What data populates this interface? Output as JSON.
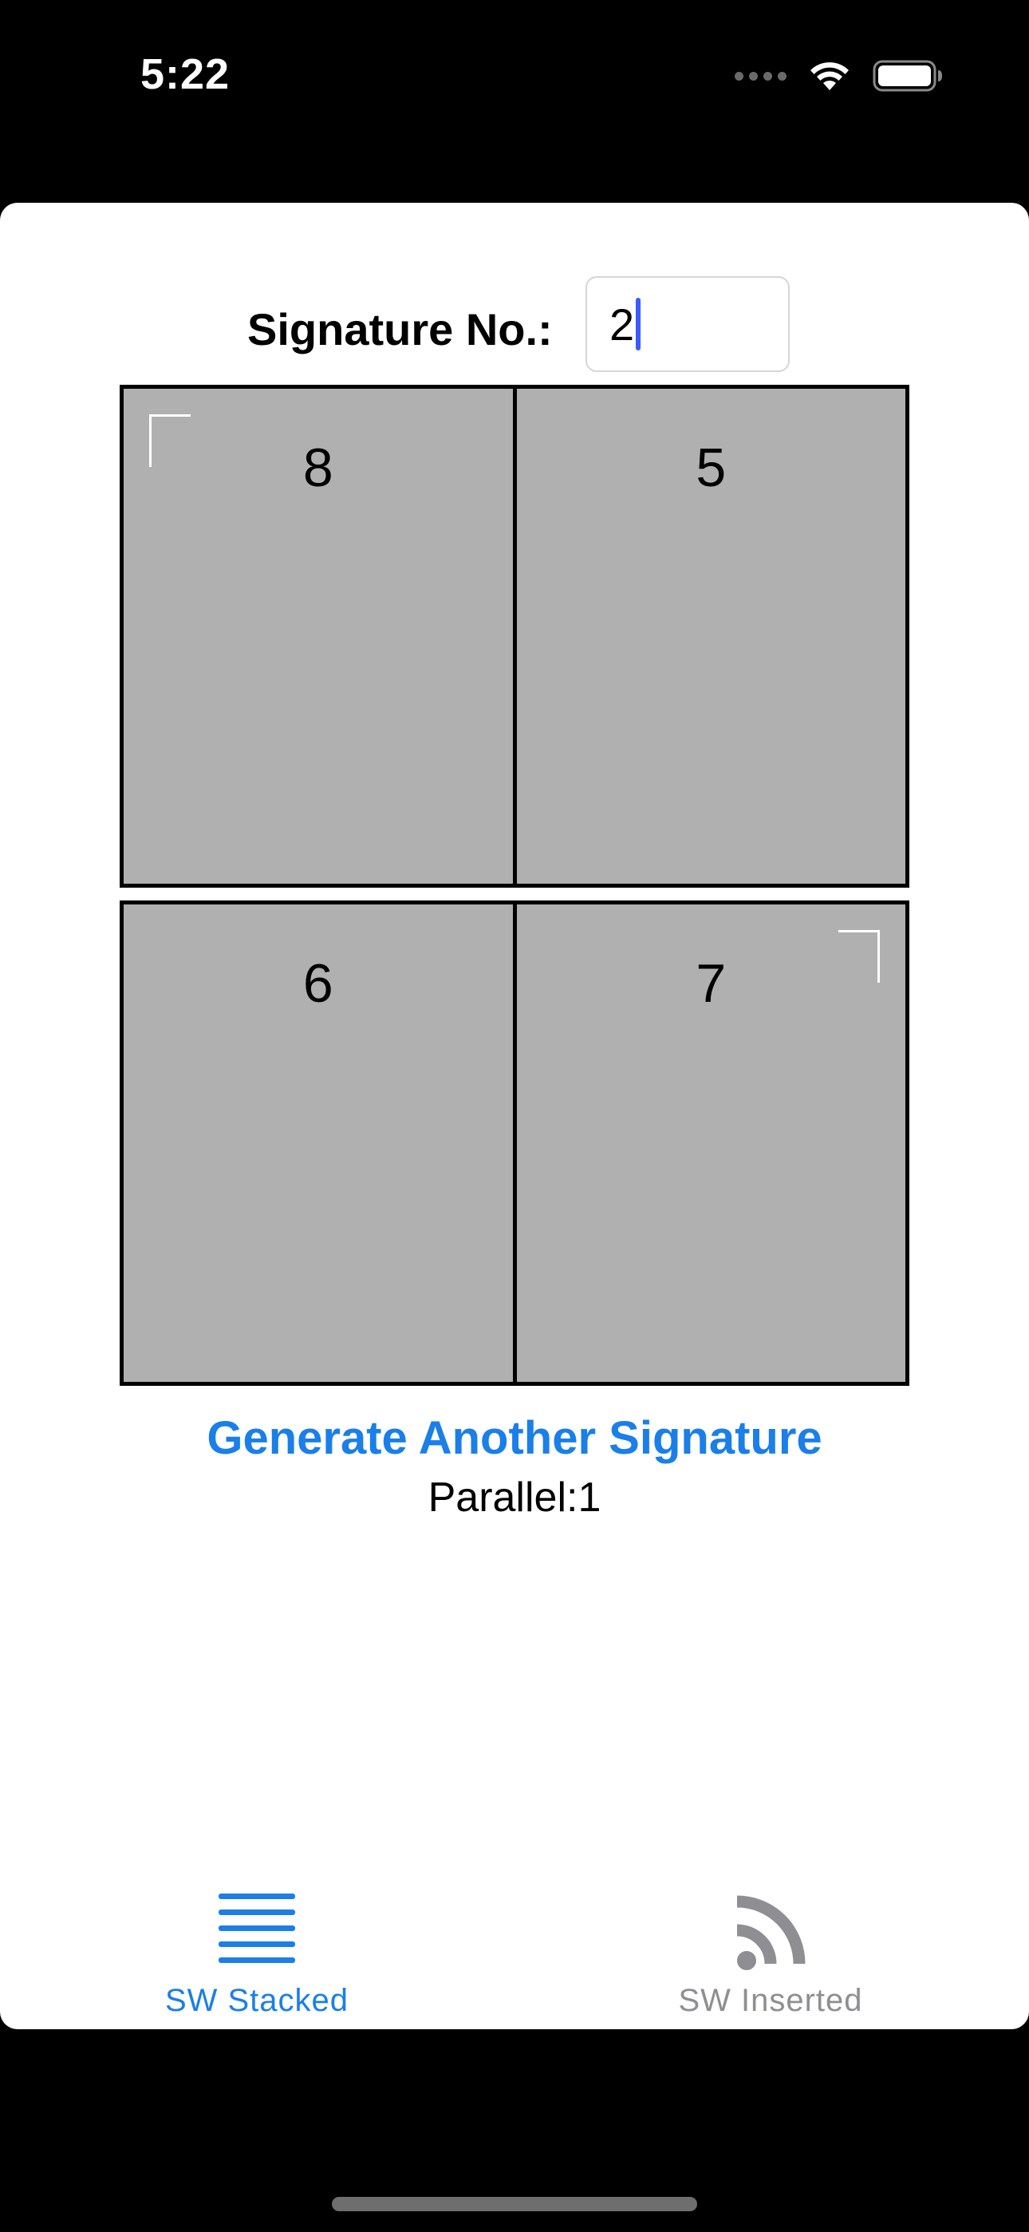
{
  "status_bar": {
    "time": "5:22"
  },
  "signature": {
    "label": "Signature No.:",
    "value": "2"
  },
  "panels": {
    "top": {
      "left": {
        "page": "8",
        "corner": "top-left"
      },
      "right": {
        "page": "5"
      }
    },
    "bottom": {
      "left": {
        "page": "6"
      },
      "right": {
        "page": "7",
        "corner": "top-right"
      }
    }
  },
  "actions": {
    "generate_label": "Generate Another Signature",
    "parallel_text": "Parallel:1"
  },
  "tab_bar": {
    "tabs": [
      {
        "label": "SW Stacked",
        "icon": "stacked-lines-icon",
        "selected": true
      },
      {
        "label": "SW Inserted",
        "icon": "rss-feed-icon",
        "selected": false
      }
    ]
  },
  "colors": {
    "accent": "#1a7fe8",
    "panel_fill": "#b0b0b0",
    "tab_inactive": "#8e8e93"
  }
}
